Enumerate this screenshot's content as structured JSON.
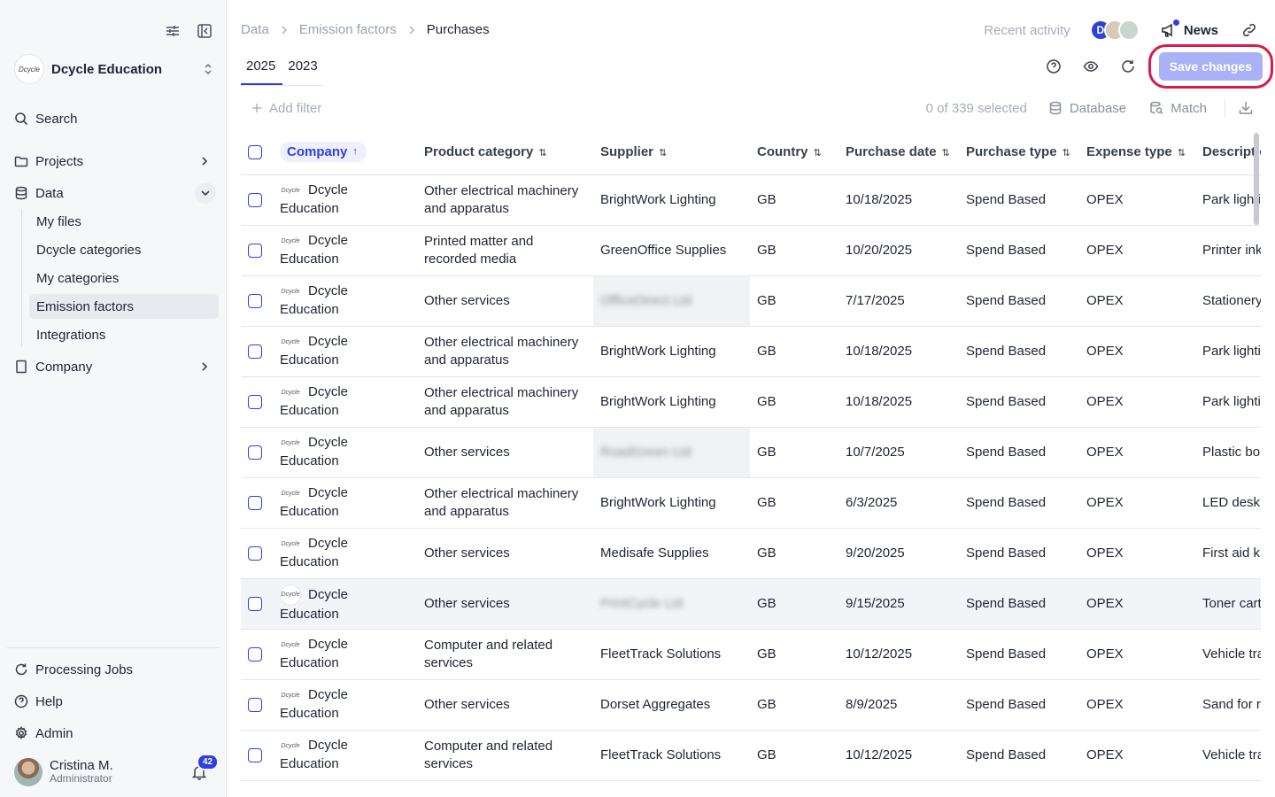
{
  "sidebar": {
    "org_name": "Dcycle Education",
    "org_logo_text": "Dcycle",
    "search": "Search",
    "projects": "Projects",
    "data": "Data",
    "data_children": [
      "My files",
      "Dcycle categories",
      "My categories",
      "Emission factors",
      "Integrations"
    ],
    "company": "Company",
    "processing_jobs": "Processing Jobs",
    "help": "Help",
    "admin": "Admin",
    "user_name": "Cristina M.",
    "user_role": "Administrator",
    "notifications_count": "42"
  },
  "header": {
    "breadcrumb": [
      "Data",
      "Emission factors",
      "Purchases"
    ],
    "recent_activity": "Recent activity",
    "avatar_initial": "D",
    "news": "News"
  },
  "tabs": [
    "2025",
    "2023"
  ],
  "toolbar": {
    "save_label": "Save changes",
    "add_filter": "Add filter",
    "selection": "0 of 339 selected",
    "database": "Database",
    "match": "Match"
  },
  "colors": {
    "accent": "#2f3fe0",
    "highlight_ring": "#d81b4a",
    "save_button": "#a9b1f7"
  },
  "table": {
    "columns": [
      "Company",
      "Product category",
      "Supplier",
      "Country",
      "Purchase date",
      "Purchase type",
      "Expense type",
      "Description"
    ],
    "rows": [
      [
        "Dcycle Education",
        "Other electrical machinery and apparatus",
        "BrightWork Lighting",
        "GB",
        "10/18/2025",
        "Spend Based",
        "OPEX",
        "Park lighting"
      ],
      [
        "Dcycle Education",
        "Printed matter and recorded media",
        "GreenOffice Supplies",
        "GB",
        "10/20/2025",
        "Spend Based",
        "OPEX",
        "Printer ink (remanufactured)"
      ],
      [
        "Dcycle Education",
        "Other services",
        "OfficeDirect Ltd",
        "GB",
        "7/17/2025",
        "Spend Based",
        "OPEX",
        "Stationery"
      ],
      [
        "Dcycle Education",
        "Other electrical machinery and apparatus",
        "BrightWork Lighting",
        "GB",
        "10/18/2025",
        "Spend Based",
        "OPEX",
        "Park lighting"
      ],
      [
        "Dcycle Education",
        "Other electrical machinery and apparatus",
        "BrightWork Lighting",
        "GB",
        "10/18/2025",
        "Spend Based",
        "OPEX",
        "Park lighting"
      ],
      [
        "Dcycle Education",
        "Other services",
        "RoadGreen Ltd",
        "GB",
        "10/7/2025",
        "Spend Based",
        "OPEX",
        "Plastic bollards"
      ],
      [
        "Dcycle Education",
        "Other electrical machinery and apparatus",
        "BrightWork Lighting",
        "GB",
        "6/3/2025",
        "Spend Based",
        "OPEX",
        "LED desk lamps"
      ],
      [
        "Dcycle Education",
        "Other services",
        "Medisafe Supplies",
        "GB",
        "9/20/2025",
        "Spend Based",
        "OPEX",
        "First aid kits"
      ],
      [
        "Dcycle Education",
        "Other services",
        "PrintCycle Ltd",
        "GB",
        "9/15/2025",
        "Spend Based",
        "OPEX",
        "Toner cartridge service"
      ],
      [
        "Dcycle Education",
        "Computer and related services",
        "FleetTrack Solutions",
        "GB",
        "10/12/2025",
        "Spend Based",
        "OPEX",
        "Vehicle tracking"
      ],
      [
        "Dcycle Education",
        "Other services",
        "Dorset Aggregates",
        "GB",
        "8/9/2025",
        "Spend Based",
        "OPEX",
        "Sand for repairs"
      ],
      [
        "Dcycle Education",
        "Computer and related services",
        "FleetTrack Solutions",
        "GB",
        "10/12/2025",
        "Spend Based",
        "OPEX",
        "Vehicle tracking"
      ]
    ]
  }
}
